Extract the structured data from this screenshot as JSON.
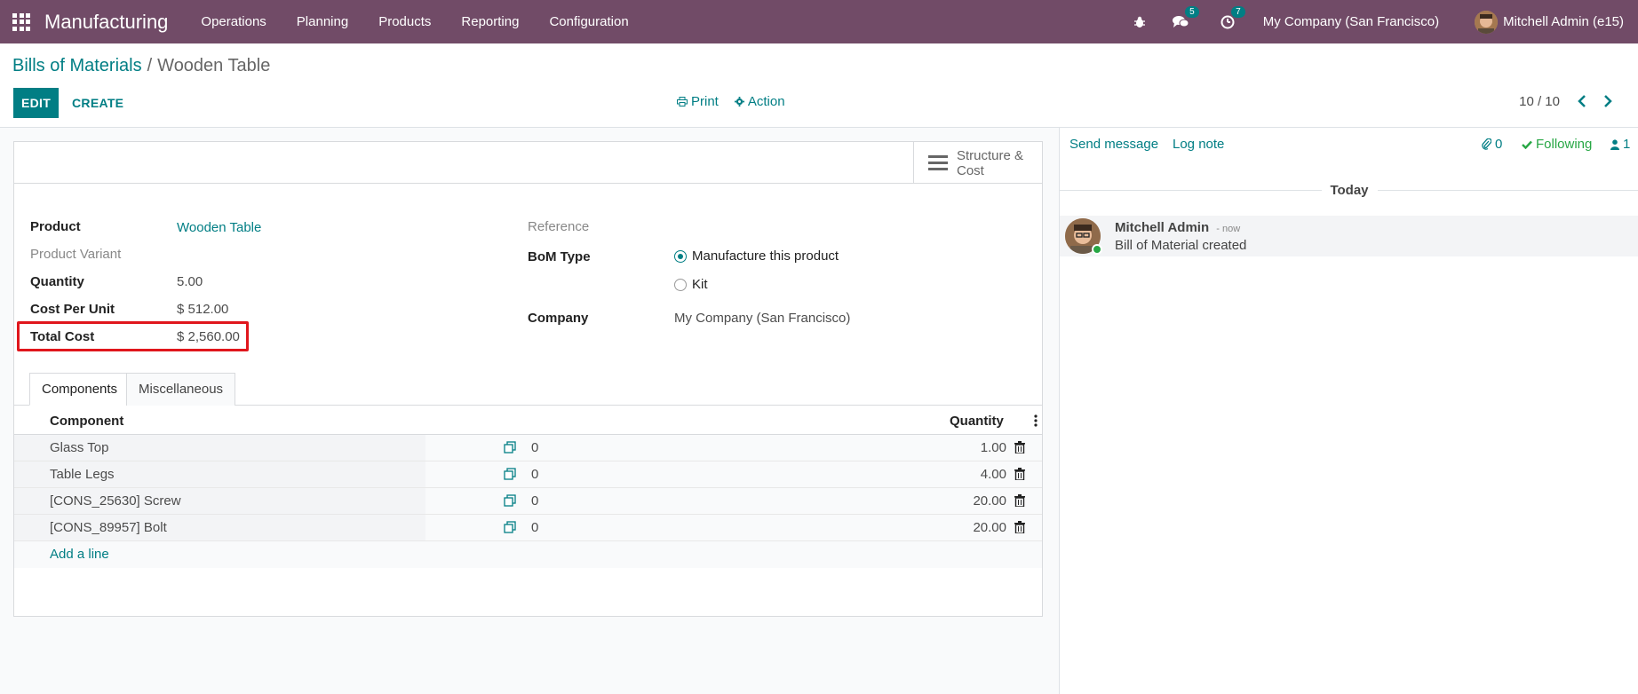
{
  "navbar": {
    "app_name": "Manufacturing",
    "menu": [
      "Operations",
      "Planning",
      "Products",
      "Reporting",
      "Configuration"
    ],
    "messages_count": "5",
    "activities_count": "7",
    "company": "My Company (San Francisco)",
    "user": "Mitchell Admin (e15)"
  },
  "breadcrumb": {
    "parent": "Bills of Materials",
    "separator": "/",
    "current": "Wooden Table"
  },
  "toolbar": {
    "edit_label": "EDIT",
    "create_label": "CREATE",
    "print_label": "Print",
    "action_label": "Action",
    "pager": "10 / 10"
  },
  "smart_button": {
    "line1": "Structure &",
    "line2": "Cost"
  },
  "form": {
    "product_label": "Product",
    "product_value": "Wooden Table",
    "variant_label": "Product Variant",
    "quantity_label": "Quantity",
    "quantity_value": "5.00",
    "cost_unit_label": "Cost Per Unit",
    "cost_unit_value": "$ 512.00",
    "total_cost_label": "Total Cost",
    "total_cost_value": "$ 2,560.00",
    "reference_label": "Reference",
    "bom_type_label": "BoM Type",
    "bom_type_options": [
      "Manufacture this product",
      "Kit"
    ],
    "company_label": "Company",
    "company_value": "My Company (San Francisco)"
  },
  "tabs": [
    "Components",
    "Miscellaneous"
  ],
  "table": {
    "headers": {
      "component": "Component",
      "quantity": "Quantity"
    },
    "rows": [
      {
        "component": "Glass Top",
        "mid": "0",
        "quantity": "1.00"
      },
      {
        "component": "Table Legs",
        "mid": "0",
        "quantity": "4.00"
      },
      {
        "component": "[CONS_25630] Screw",
        "mid": "0",
        "quantity": "20.00"
      },
      {
        "component": "[CONS_89957] Bolt",
        "mid": "0",
        "quantity": "20.00"
      }
    ],
    "add_line": "Add a line"
  },
  "chatter": {
    "send_message": "Send message",
    "log_note": "Log note",
    "attachments": "0",
    "following": "Following",
    "followers": "1",
    "today": "Today",
    "message": {
      "author": "Mitchell Admin",
      "time": "- now",
      "body": "Bill of Material created"
    }
  },
  "colors": {
    "navbar": "#714b67",
    "primary": "#017e84",
    "highlight": "#e0161c",
    "following": "#28a745"
  }
}
